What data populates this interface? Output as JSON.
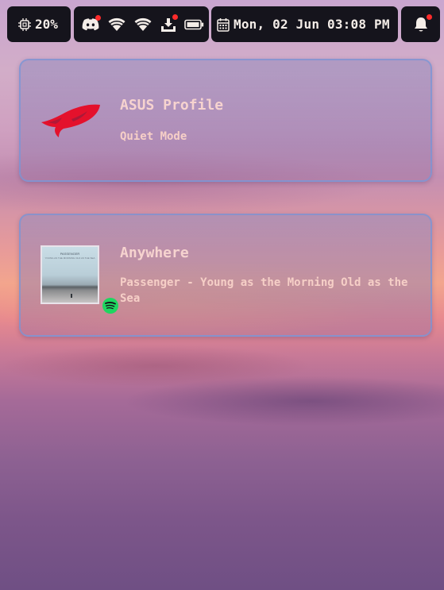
{
  "topbar": {
    "cpu": {
      "icon": "cpu-chip-icon",
      "label": "20%"
    },
    "tray": {
      "icons": [
        "discord-icon",
        "wifi-icon",
        "wifi-icon",
        "download-icon",
        "battery-icon"
      ]
    },
    "clock": {
      "icon": "calendar-icon",
      "label": "Mon, 02 Jun 03:08 PM"
    },
    "notifications": {
      "icon": "bell-icon"
    }
  },
  "cards": {
    "asus": {
      "icon": "rog-logo",
      "title": "ASUS Profile",
      "subtitle": "Quiet Mode"
    },
    "music": {
      "title": "Anywhere",
      "subtitle": "Passenger - Young as the Morning Old as the Sea",
      "album_art": {
        "title": "PASSENGER",
        "subtitle": "YOUNG AS THE MORNING OLD AS THE SEA"
      },
      "source_icon": "spotify-icon"
    }
  },
  "colors": {
    "bar_bg": "#15141c",
    "text_light": "#f4ede8",
    "card_text": "#f6d3cf",
    "card_border": "#7896d7",
    "badge_red": "#ff2b2b",
    "rog_red": "#e4112c",
    "spotify_green": "#1ed760"
  }
}
